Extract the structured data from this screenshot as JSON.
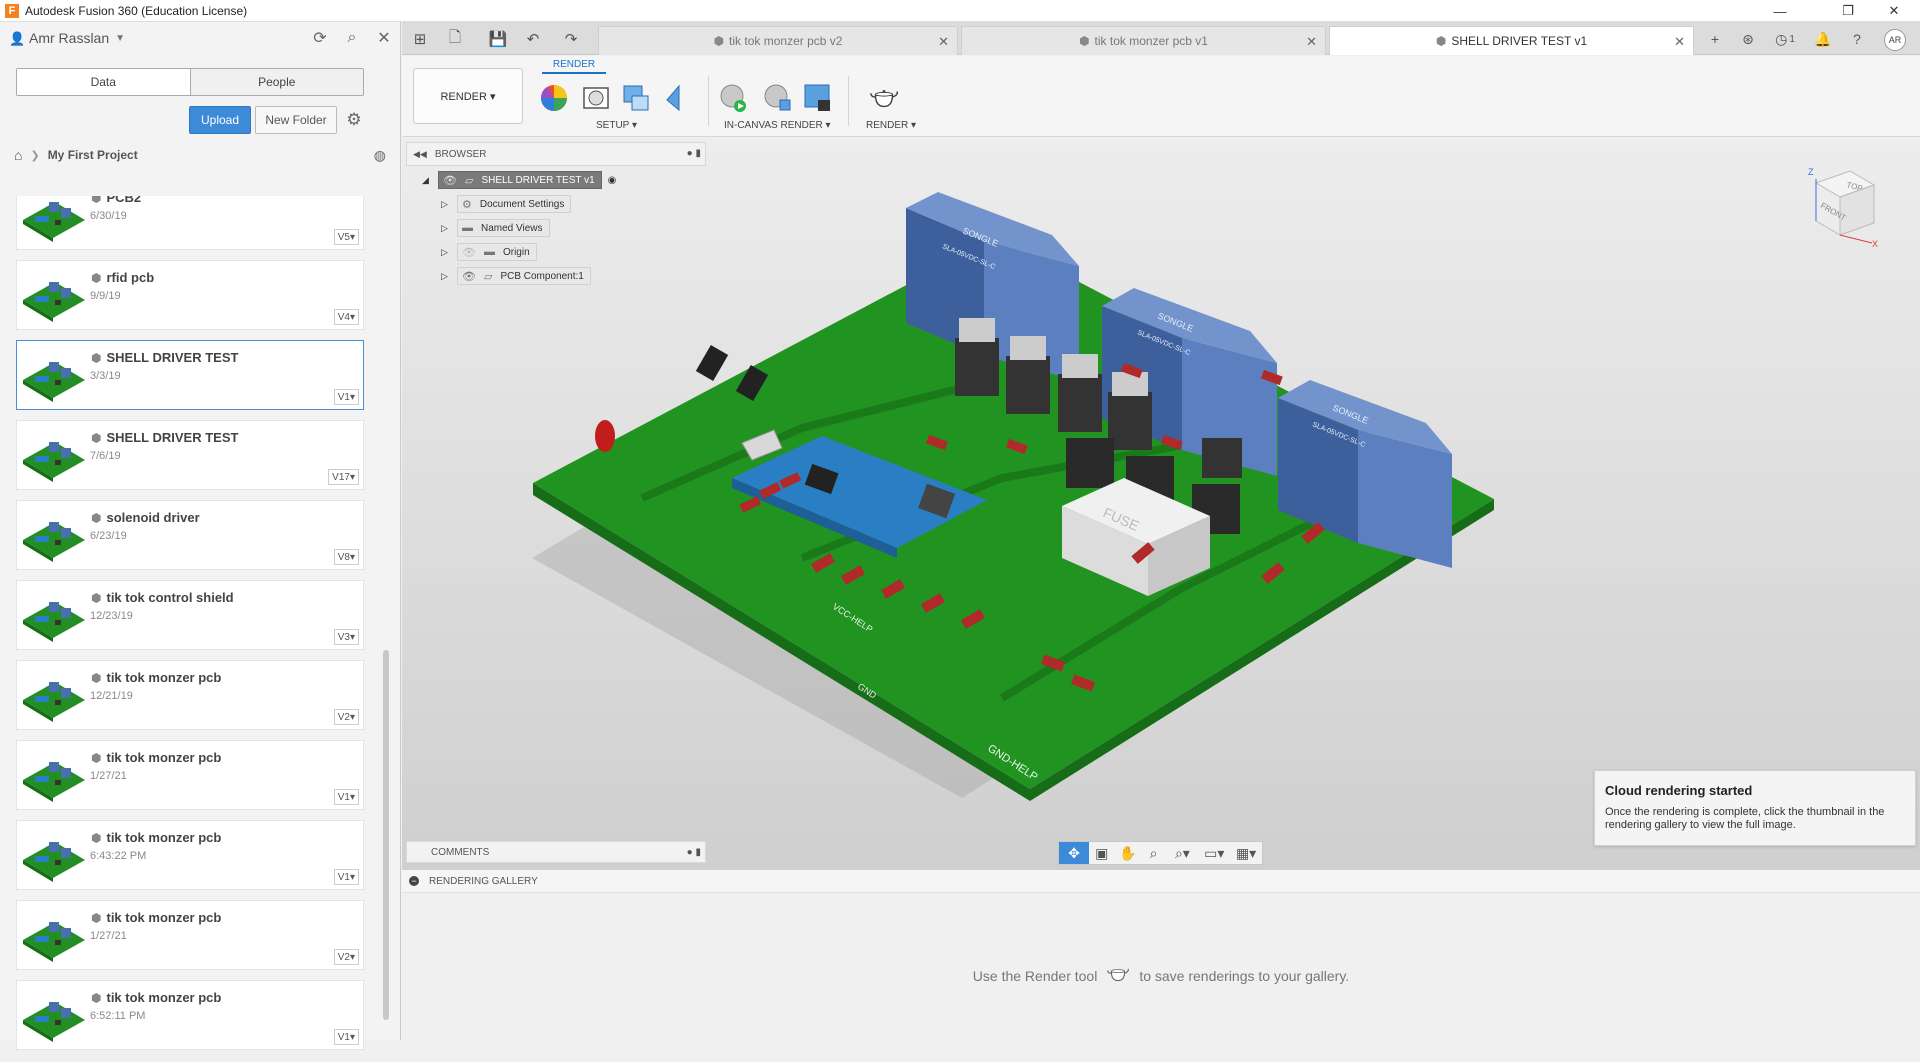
{
  "window": {
    "title": "Autodesk Fusion 360 (Education License)",
    "app_icon": "F",
    "controls": [
      "—",
      "❐",
      "✕"
    ]
  },
  "data_panel": {
    "user_name": "Amr Rasslan",
    "tabs": [
      "Data",
      "People"
    ],
    "upload_label": "Upload",
    "new_folder_label": "New Folder",
    "breadcrumb_project": "My First Project",
    "files": [
      {
        "name": "PCB2",
        "date": "6/30/19",
        "version": "V5"
      },
      {
        "name": "rfid pcb",
        "date": "9/9/19",
        "version": "V4"
      },
      {
        "name": "SHELL DRIVER TEST",
        "date": "3/3/19",
        "version": "V1",
        "selected": true
      },
      {
        "name": "SHELL DRIVER TEST",
        "date": "7/6/19",
        "version": "V17"
      },
      {
        "name": "solenoid driver",
        "date": "6/23/19",
        "version": "V8"
      },
      {
        "name": "tik tok control shield",
        "date": "12/23/19",
        "version": "V3"
      },
      {
        "name": "tik tok monzer pcb",
        "date": "12/21/19",
        "version": "V2"
      },
      {
        "name": "tik tok monzer pcb",
        "date": "1/27/21",
        "version": "V1"
      },
      {
        "name": "tik tok monzer pcb",
        "date": "6:43:22 PM",
        "version": "V1"
      },
      {
        "name": "tik tok monzer pcb",
        "date": "1/27/21",
        "version": "V2"
      },
      {
        "name": "tik tok monzer pcb",
        "date": "6:52:11 PM",
        "version": "V1"
      }
    ]
  },
  "doc_tabs": [
    {
      "label": "tik tok monzer pcb v2",
      "active": false
    },
    {
      "label": "tik tok monzer pcb v1",
      "active": false
    },
    {
      "label": "SHELL DRIVER TEST v1",
      "active": true
    }
  ],
  "header_right": {
    "job_count": "1",
    "avatar_initials": "AR"
  },
  "toolbar": {
    "workspace": "RENDER ▾",
    "ribbon_tab": "RENDER",
    "groups": {
      "setup": "SETUP ▾",
      "in_canvas": "IN-CANVAS RENDER ▾",
      "render": "RENDER ▾"
    }
  },
  "browser": {
    "title": "BROWSER",
    "root": "SHELL DRIVER TEST v1",
    "items": [
      "Document Settings",
      "Named Views",
      "Origin",
      "PCB Component:1"
    ]
  },
  "comments_label": "COMMENTS",
  "toast": {
    "title": "Cloud rendering started",
    "body": "Once the rendering is complete, click the thumbnail in the rendering gallery to view the full image."
  },
  "gallery": {
    "title": "RENDERING GALLERY",
    "hint_before": "Use the Render tool",
    "hint_after": "to save renderings to your gallery."
  },
  "pcb_labels": {
    "relay_brand": "SONGLE",
    "relay_model": "SLA-05VDC-SL-C",
    "fuse_text": "FUSE",
    "silk_gnd_help": "GND-HELP",
    "silk_gnd": "GND",
    "silk_vcc_help": "VCC-HELP"
  },
  "viewcube": {
    "top": "TOP",
    "front": "FRONT",
    "axis_z": "Z",
    "axis_x": "X"
  },
  "colors": {
    "accent": "#3d8bd8",
    "pcb_green": "#1f8c1f",
    "relay_blue": "#4a6fb0",
    "board_blue": "#2a7fc4"
  }
}
